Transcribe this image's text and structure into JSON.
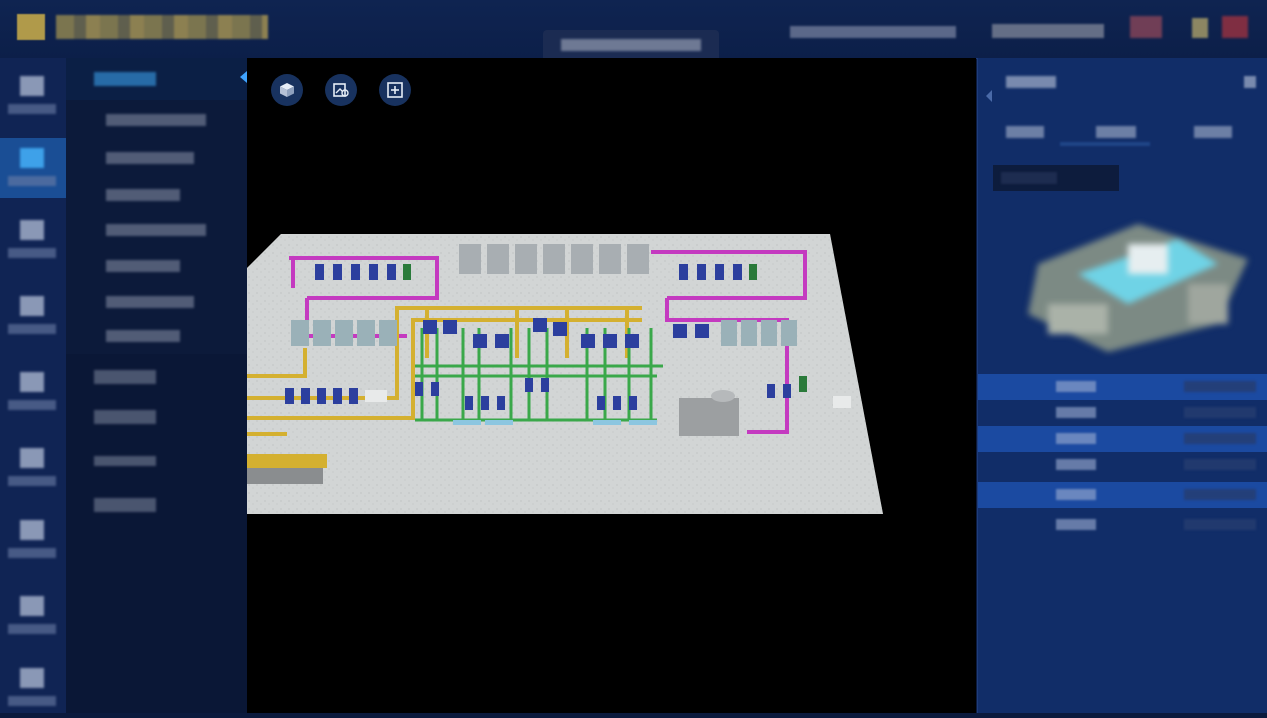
{
  "app": {
    "title": "",
    "header_center_label": "",
    "header_right": []
  },
  "nav": {
    "rail_items": [
      {
        "label": ""
      },
      {
        "label": ""
      },
      {
        "label": ""
      },
      {
        "label": ""
      },
      {
        "label": ""
      },
      {
        "label": ""
      },
      {
        "label": ""
      },
      {
        "label": ""
      },
      {
        "label": ""
      }
    ],
    "active_index": 1,
    "submenu": {
      "group_title": "",
      "group_items": [
        {
          "label": ""
        },
        {
          "label": ""
        },
        {
          "label": ""
        },
        {
          "label": ""
        },
        {
          "label": ""
        },
        {
          "label": ""
        },
        {
          "label": ""
        }
      ],
      "items": [
        {
          "label": ""
        },
        {
          "label": ""
        },
        {
          "label": ""
        },
        {
          "label": ""
        }
      ]
    }
  },
  "toolbar": {
    "icons": [
      "cube-icon",
      "map-layers-icon",
      "fit-view-icon"
    ]
  },
  "viewport": {
    "background": "#000000",
    "pipe_colors": {
      "supply": "#d4b030",
      "return": "#c43ac0",
      "branch": "#3aa84a"
    }
  },
  "right_panel": {
    "title": "",
    "tabs": [
      {
        "label": ""
      },
      {
        "label": ""
      },
      {
        "label": ""
      }
    ],
    "sub_label": "",
    "rows": [
      {
        "key": "",
        "value": ""
      },
      {
        "key": "",
        "value": ""
      },
      {
        "key": "",
        "value": ""
      },
      {
        "key": "",
        "value": ""
      },
      {
        "key": "",
        "value": ""
      },
      {
        "key": "",
        "value": ""
      }
    ]
  },
  "colors": {
    "accent": "#3fa3ff",
    "panel": "#112d68",
    "header": "#0f2451"
  }
}
